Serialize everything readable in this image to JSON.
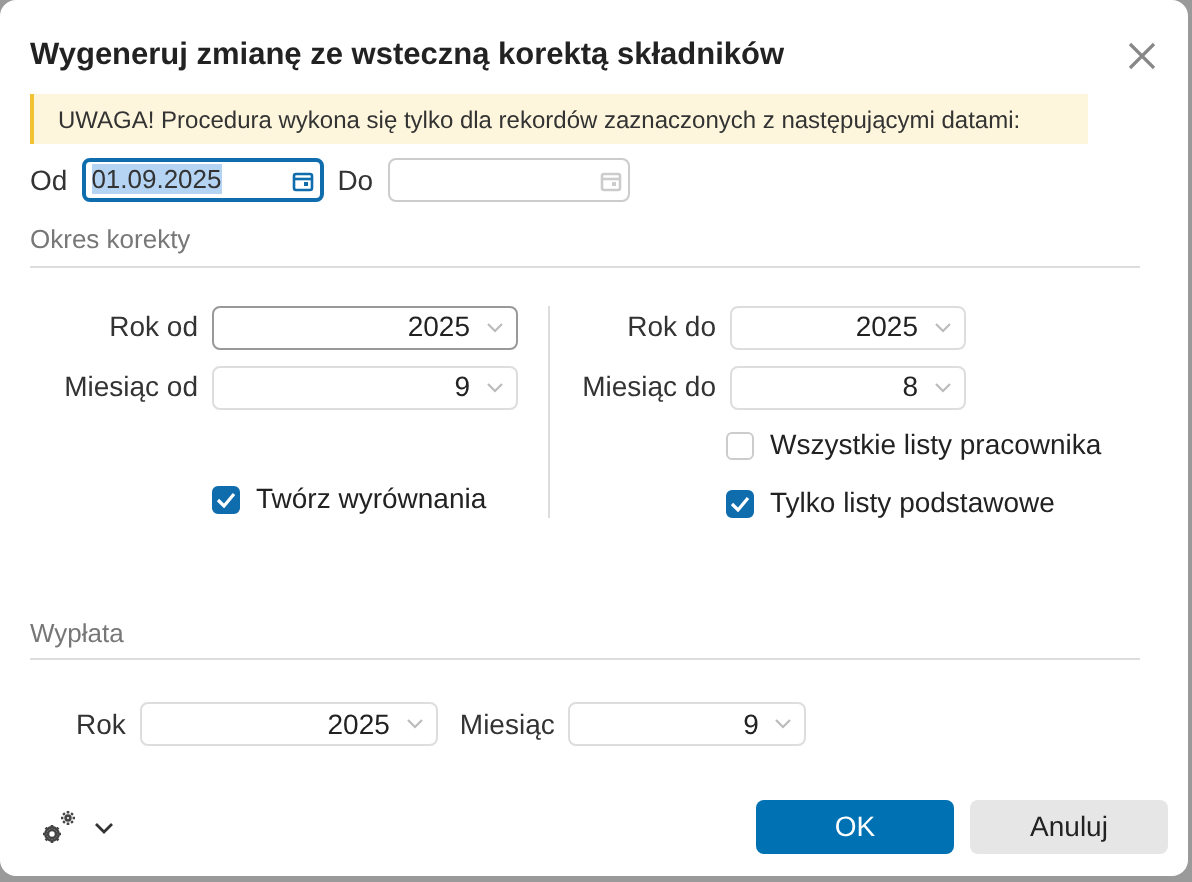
{
  "dialog": {
    "title": "Wygeneruj zmianę ze wsteczną korektą składników"
  },
  "warning": "UWAGA! Procedura wykona się tylko dla rekordów zaznaczonych z następującymi datami:",
  "date_range": [
    {
      "label": "Od",
      "value": "01.09.2025",
      "focused": true
    },
    {
      "label": "Do",
      "focused": false
    }
  ],
  "correction_period": {
    "title": "Okres korekty",
    "left": [
      {
        "label": "Rok od",
        "value": "2025",
        "focused": true
      },
      {
        "label": "Miesiąc od",
        "value": "9",
        "focused": false
      }
    ],
    "right": [
      {
        "label": "Rok do",
        "value": "2025",
        "focused": false
      },
      {
        "label": "Miesiąc do",
        "value": "8",
        "focused": false
      }
    ],
    "left_checkboxes": [
      {
        "label": "Twórz wyrównania",
        "checked": true
      }
    ],
    "right_checkboxes": [
      {
        "label": "Wszystkie listy pracownika",
        "checked": false
      },
      {
        "label": "Tylko listy podstawowe",
        "checked": true
      }
    ]
  },
  "payout": {
    "title": "Wypłata",
    "fields": [
      {
        "label": "Rok",
        "value": "2025"
      },
      {
        "label": "Miesiąc",
        "value": "9"
      }
    ]
  },
  "buttons": [
    {
      "label": "OK",
      "kind": "primary"
    },
    {
      "label": "Anuluj",
      "kind": "secondary"
    }
  ]
}
